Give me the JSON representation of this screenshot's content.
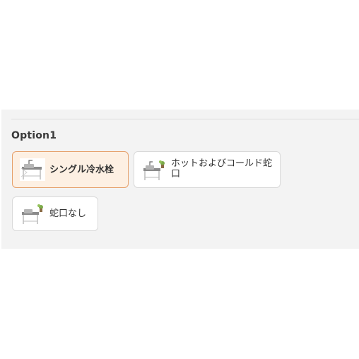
{
  "section": {
    "title": "Option1"
  },
  "options": [
    {
      "label": "シングル冷水栓",
      "selected": true,
      "icon": "sink-single-faucet-icon"
    },
    {
      "label": "ホットおよびコールド蛇口",
      "selected": false,
      "icon": "sink-hot-cold-faucet-icon"
    },
    {
      "label": "蛇口なし",
      "selected": false,
      "icon": "sink-no-faucet-icon"
    }
  ],
  "colors": {
    "selected_border": "#e6a06a",
    "selected_background": "#fdf0e3",
    "panel_background": "#f3f3f3"
  }
}
